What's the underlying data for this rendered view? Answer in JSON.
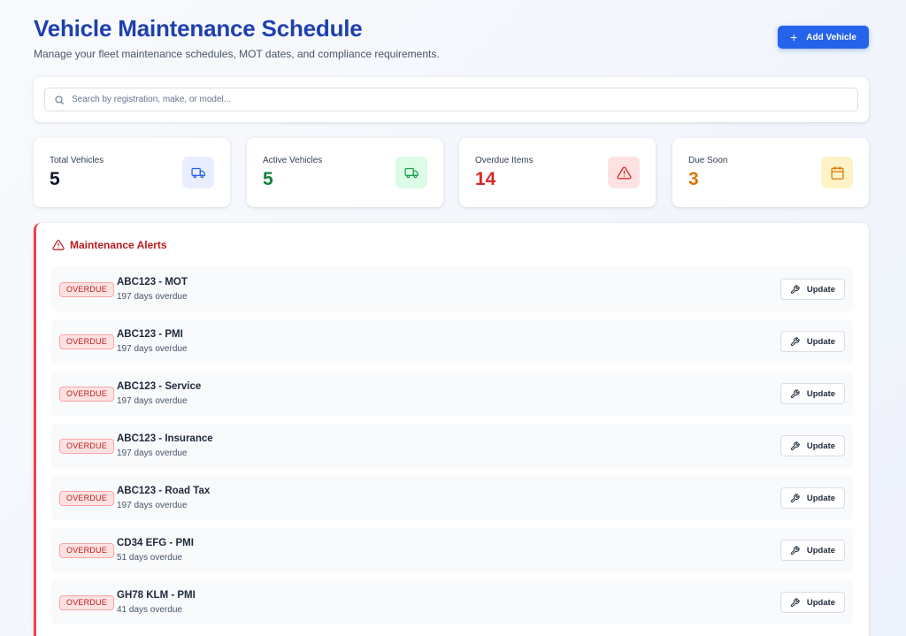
{
  "header": {
    "title": "Vehicle Maintenance Schedule",
    "subtitle": "Manage your fleet maintenance schedules, MOT dates, and compliance requirements.",
    "add_button": "Add Vehicle"
  },
  "search": {
    "placeholder": "Search by registration, make, or model...",
    "value": ""
  },
  "stats": [
    {
      "label": "Total Vehicles",
      "value": "5",
      "color": "#0f172a",
      "icon": "truck-icon",
      "icon_bg": "#e8eefd",
      "icon_color": "#2563eb"
    },
    {
      "label": "Active Vehicles",
      "value": "5",
      "color": "#15803d",
      "icon": "truck-icon",
      "icon_bg": "#dcfce7",
      "icon_color": "#16a34a"
    },
    {
      "label": "Overdue Items",
      "value": "14",
      "color": "#dc2626",
      "icon": "alert-triangle-icon",
      "icon_bg": "#fee2e2",
      "icon_color": "#dc2626"
    },
    {
      "label": "Due Soon",
      "value": "3",
      "color": "#d97706",
      "icon": "calendar-icon",
      "icon_bg": "#fef3c7",
      "icon_color": "#d97706"
    }
  ],
  "alerts": {
    "title": "Maintenance Alerts",
    "items": [
      {
        "badge": "OVERDUE",
        "title": "ABC123 - MOT",
        "detail": "197 days overdue",
        "action": "Update"
      },
      {
        "badge": "OVERDUE",
        "title": "ABC123 - PMI",
        "detail": "197 days overdue",
        "action": "Update"
      },
      {
        "badge": "OVERDUE",
        "title": "ABC123 - Service",
        "detail": "197 days overdue",
        "action": "Update"
      },
      {
        "badge": "OVERDUE",
        "title": "ABC123 - Insurance",
        "detail": "197 days overdue",
        "action": "Update"
      },
      {
        "badge": "OVERDUE",
        "title": "ABC123 - Road Tax",
        "detail": "197 days overdue",
        "action": "Update"
      },
      {
        "badge": "OVERDUE",
        "title": "CD34 EFG - PMI",
        "detail": "51 days overdue",
        "action": "Update"
      },
      {
        "badge": "OVERDUE",
        "title": "GH78 KLM - PMI",
        "detail": "41 days overdue",
        "action": "Update"
      }
    ]
  },
  "colors": {
    "accent": "#2563eb",
    "title": "#1e40af",
    "danger": "#dc2626"
  }
}
